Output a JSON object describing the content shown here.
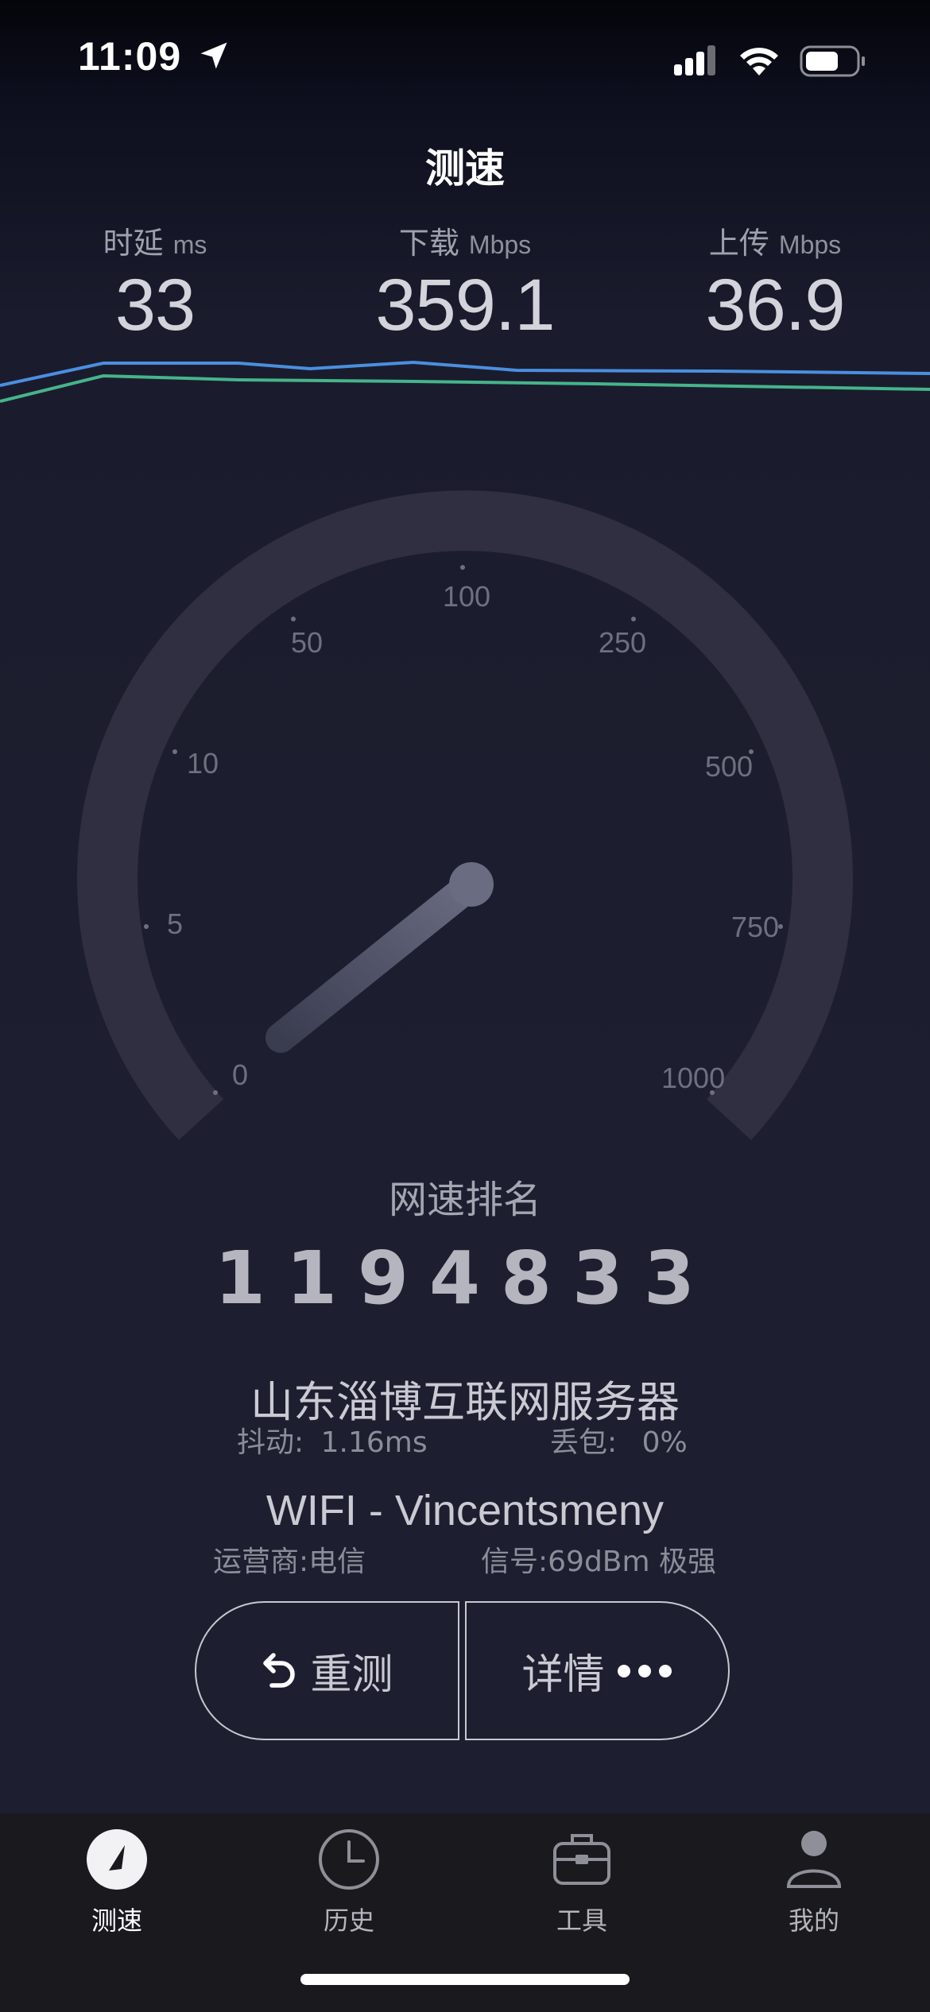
{
  "status": {
    "time": "11:09"
  },
  "page": {
    "title": "测速"
  },
  "metrics": {
    "latency": {
      "label": "时延",
      "unit": "ms",
      "value": "33"
    },
    "download": {
      "label": "下载",
      "unit": "Mbps",
      "value": "359.1"
    },
    "upload": {
      "label": "上传",
      "unit": "Mbps",
      "value": "36.9"
    }
  },
  "gauge": {
    "ticks": [
      "0",
      "5",
      "10",
      "50",
      "100",
      "250",
      "500",
      "750",
      "1000"
    ]
  },
  "rank": {
    "label": "网速排名",
    "value": "1194833"
  },
  "server": {
    "name": "山东淄博互联网服务器",
    "jitter_label": "抖动:",
    "jitter_value": "1.16ms",
    "loss_label": "丢包:",
    "loss_value": "0%"
  },
  "network": {
    "name": "WIFI - Vincentsmeny",
    "carrier": "运营商:电信",
    "signal": "信号:69dBm 极强"
  },
  "buttons": {
    "retest": "重测",
    "details": "详情"
  },
  "tabs": [
    {
      "label": "测速",
      "icon": "speedometer-icon",
      "active": true
    },
    {
      "label": "历史",
      "icon": "clock-icon",
      "active": false
    },
    {
      "label": "工具",
      "icon": "toolbox-icon",
      "active": false
    },
    {
      "label": "我的",
      "icon": "person-icon",
      "active": false
    }
  ],
  "colors": {
    "download_line": "#4a8fe0",
    "upload_line": "#46b48a",
    "background": "#1d1f30"
  }
}
